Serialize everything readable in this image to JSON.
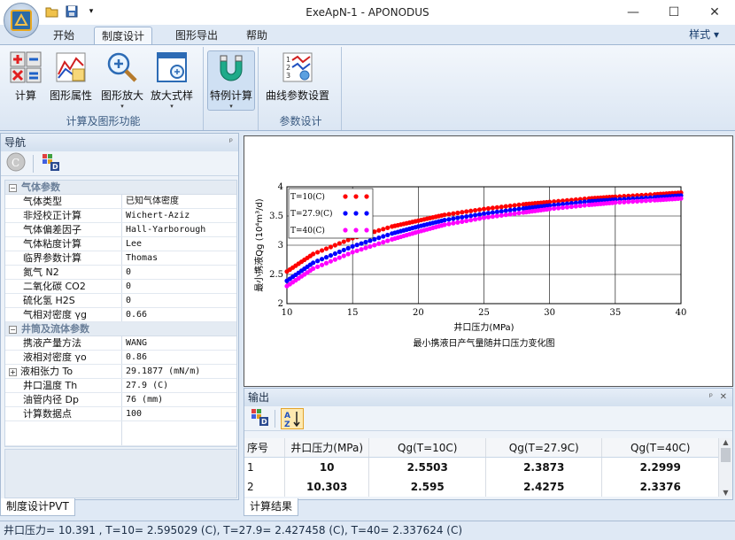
{
  "window": {
    "title": "ExeApN-1 - APONODUS",
    "minimize": "—",
    "maximize": "☐",
    "close": "✕"
  },
  "tabs": [
    "开始",
    "制度设计",
    "图形导出",
    "帮助"
  ],
  "style_menu": "样式",
  "ribbon": {
    "groups": [
      {
        "label": "计算及图形功能",
        "buttons": [
          "计算",
          "图形属性",
          "图形放大",
          "放大式样"
        ]
      },
      {
        "label": "",
        "buttons": [
          "特例计算"
        ]
      },
      {
        "label": "参数设计",
        "buttons": [
          "曲线参数设置"
        ]
      }
    ]
  },
  "nav": {
    "title": "导航",
    "pin": "ᵖ",
    "categories": [
      {
        "name": "气体参数",
        "rows": [
          {
            "key": "气体类型",
            "value": "已知气体密度"
          },
          {
            "key": "非烃校正计算",
            "value": "Wichert-Aziz"
          },
          {
            "key": "气体偏差因子",
            "value": "Hall-Yarborough"
          },
          {
            "key": "气体粘度计算",
            "value": "Lee"
          },
          {
            "key": "临界参数计算",
            "value": "Thomas"
          },
          {
            "key": "氮气 N2",
            "value": "0"
          },
          {
            "key": "二氧化碳 CO2",
            "value": "0"
          },
          {
            "key": "硫化氢 H2S",
            "value": "0"
          },
          {
            "key": "气相对密度 γg",
            "value": "0.66"
          }
        ]
      },
      {
        "name": "井筒及流体参数",
        "rows": [
          {
            "key": "携液产量方法",
            "value": "WANG"
          },
          {
            "key": "液相对密度 γo",
            "value": "0.86"
          },
          {
            "key": "液相张力 To",
            "value": "29.1877 (mN/m)",
            "expand": "+"
          },
          {
            "key": "井口温度 Th",
            "value": "27.9 (C)"
          },
          {
            "key": "油管内径 Dp",
            "value": "76 (mm)"
          },
          {
            "key": "计算数据点",
            "value": "100"
          }
        ]
      }
    ],
    "bottom_tab": "制度设计PVT"
  },
  "chart_data": {
    "type": "scatter",
    "title": "最小携液日产气量随井口压力变化图",
    "xlabel": "井口压力(MPa)",
    "ylabel": "最小携液Qg (10⁴m³/d)",
    "xlim": [
      10,
      40
    ],
    "ylim": [
      2,
      4
    ],
    "xticks": [
      "10",
      "15",
      "20",
      "25",
      "30",
      "35",
      "40"
    ],
    "yticks": [
      "2",
      "2.5",
      "3",
      "3.5",
      "4"
    ],
    "grid": true,
    "legend_position": "top-left",
    "series": [
      {
        "name": "T=10(C)",
        "color": "#ff0000",
        "x": [
          10,
          12,
          15,
          18,
          20,
          22,
          25,
          28,
          30,
          33,
          35,
          38,
          40
        ],
        "values": [
          2.55,
          2.85,
          3.12,
          3.32,
          3.42,
          3.52,
          3.62,
          3.7,
          3.74,
          3.8,
          3.83,
          3.87,
          3.9
        ]
      },
      {
        "name": "T=27.9(C)",
        "color": "#0000ff",
        "x": [
          10,
          12,
          15,
          18,
          20,
          22,
          25,
          28,
          30,
          33,
          35,
          38,
          40
        ],
        "values": [
          2.39,
          2.7,
          2.98,
          3.2,
          3.32,
          3.43,
          3.54,
          3.63,
          3.68,
          3.75,
          3.78,
          3.82,
          3.85
        ]
      },
      {
        "name": "T=40(C)",
        "color": "#ff00ff",
        "x": [
          10,
          12,
          15,
          18,
          20,
          22,
          25,
          28,
          30,
          33,
          35,
          38,
          40
        ],
        "values": [
          2.3,
          2.6,
          2.88,
          3.1,
          3.23,
          3.35,
          3.47,
          3.56,
          3.62,
          3.69,
          3.73,
          3.77,
          3.8
        ]
      }
    ]
  },
  "output": {
    "title": "输出",
    "pin": "ᵖ",
    "close": "✕",
    "columns": [
      "序号",
      "井口压力(MPa)",
      "Qg(T=10C)",
      "Qg(T=27.9C)",
      "Qg(T=40C)"
    ],
    "rows": [
      [
        "1",
        "10",
        "2.5503",
        "2.3873",
        "2.2999"
      ],
      [
        "2",
        "10.303",
        "2.595",
        "2.4275",
        "2.3376"
      ]
    ],
    "bottom_tab": "计算结果"
  },
  "status": "井口压力= 10.391 , T=10= 2.595029 (C), T=27.9= 2.427458 (C), T=40= 2.337624 (C)"
}
